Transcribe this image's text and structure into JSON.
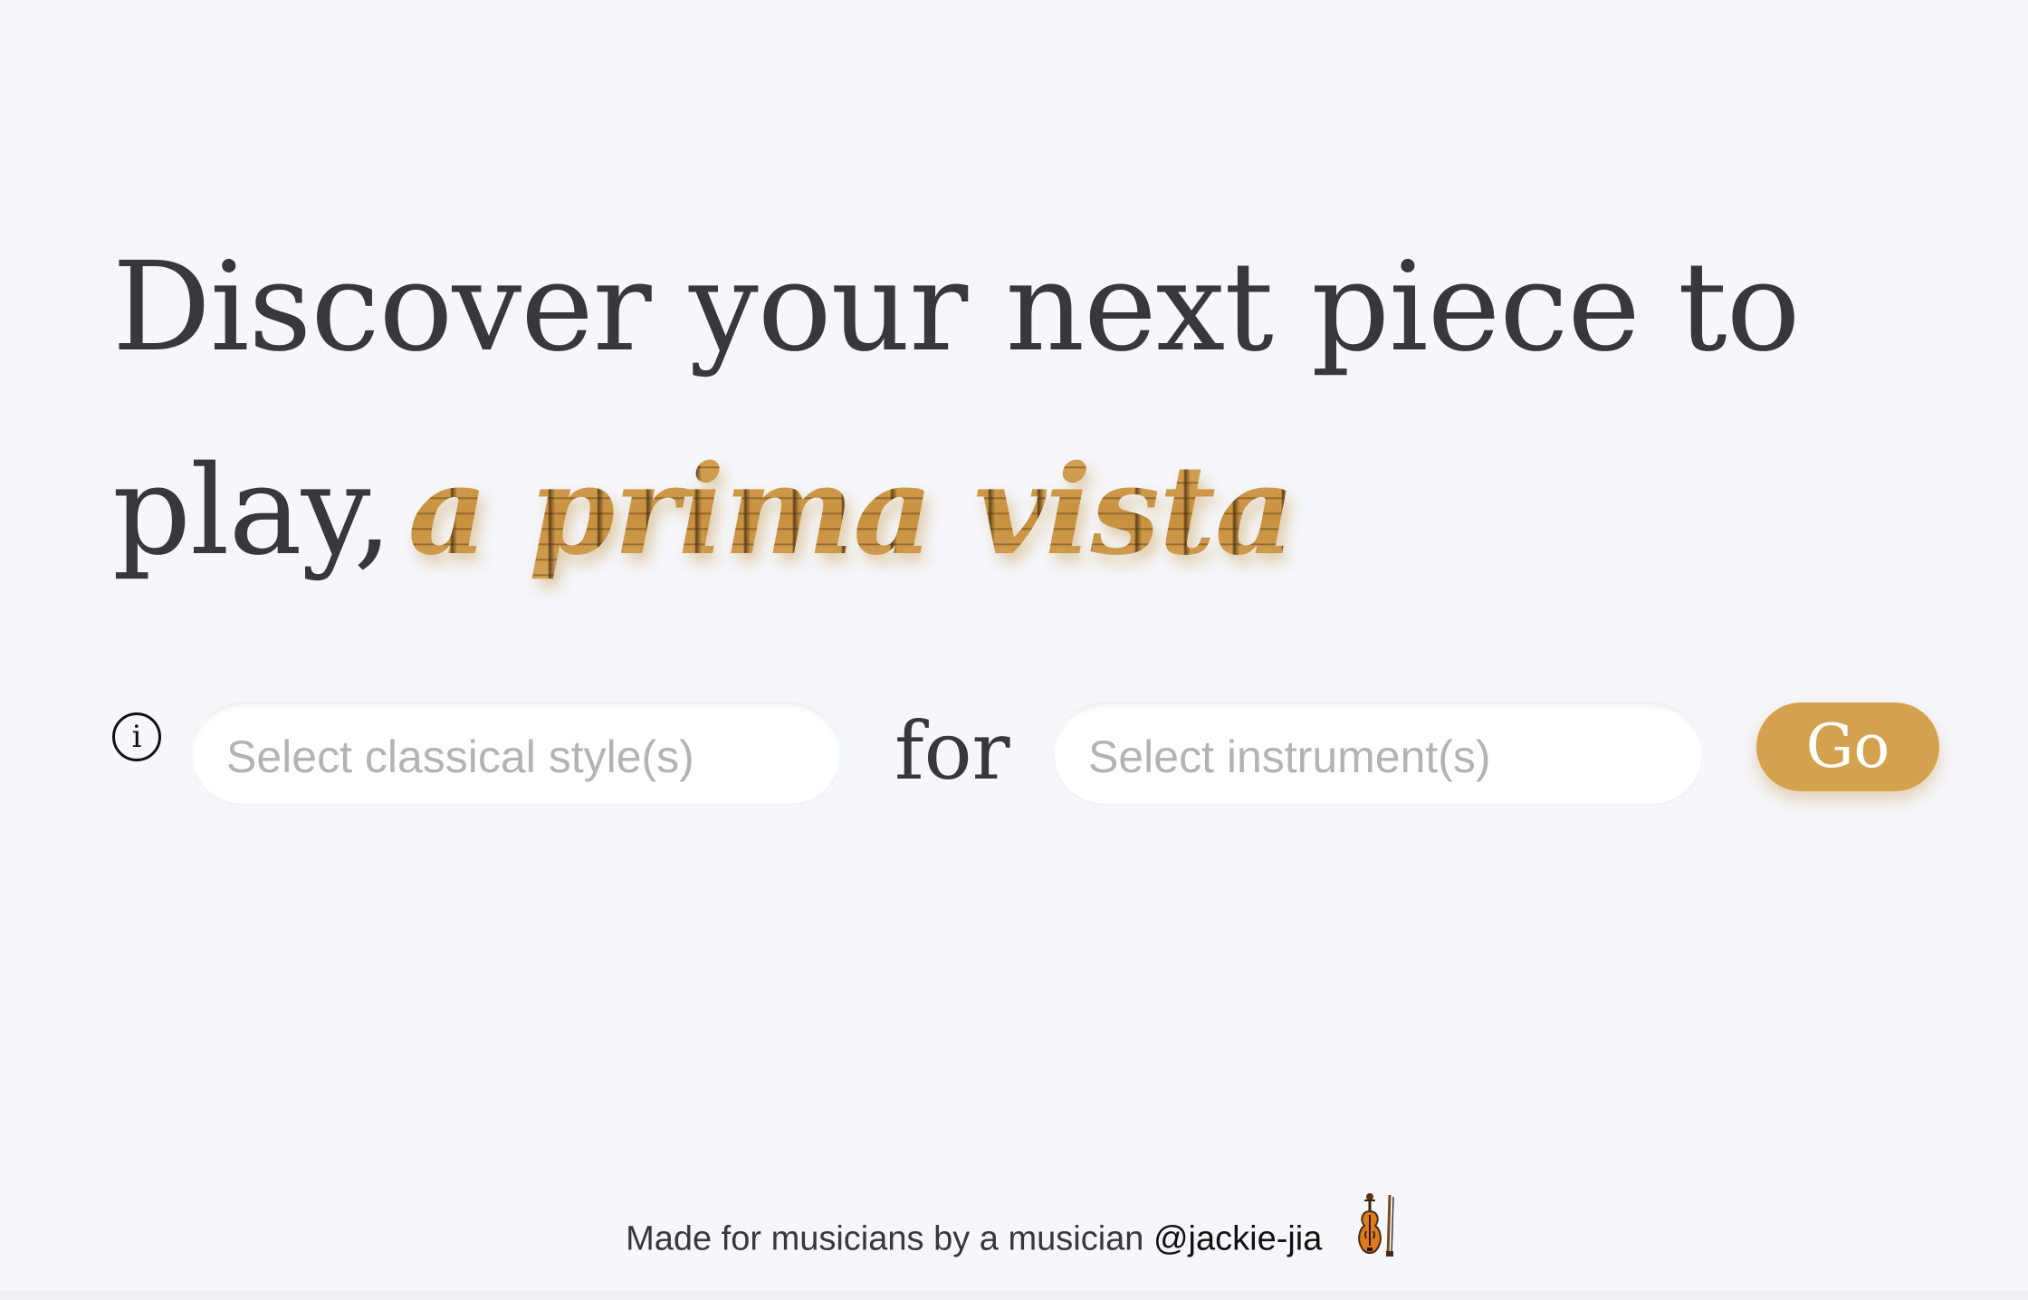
{
  "hero": {
    "line1": "Discover your next piece to",
    "line2_lead": "play,",
    "line2_accent": "a prima vista"
  },
  "search": {
    "info_icon_glyph": "i",
    "style_placeholder": "Select classical style(s)",
    "connector": "for",
    "instrument_placeholder": "Select instrument(s)",
    "go_label": "Go"
  },
  "footer": {
    "text": "Made for musicians by a musician",
    "handle": "@jackie-jia",
    "icon": "violin-icon"
  },
  "colors": {
    "background": "#f6f7fb",
    "text": "#36383b",
    "accent": "#d4a24e",
    "placeholder": "#b3b3b6"
  }
}
